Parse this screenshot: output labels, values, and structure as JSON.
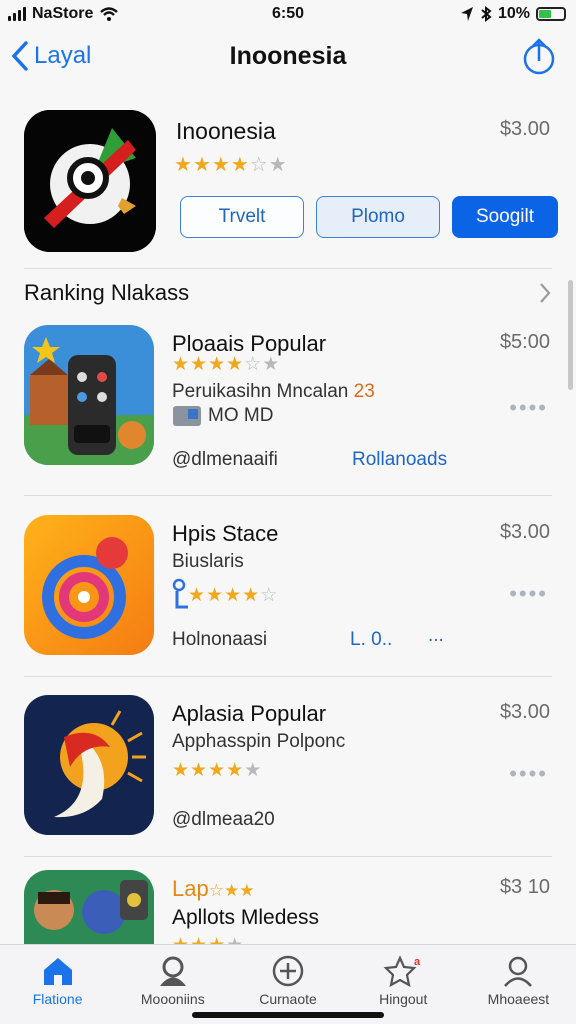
{
  "status_bar": {
    "carrier": "NaStore",
    "time": "6:50",
    "battery": "10%"
  },
  "nav": {
    "back_label": "Layal",
    "title": "Inoonesia"
  },
  "hero": {
    "name": "Inoonesia",
    "price": "$3.00",
    "rating_stars": 4,
    "rating_max": 5,
    "buttons": [
      "Trvelt",
      "Plomo",
      "Soogilt"
    ]
  },
  "section": {
    "title": "Ranking Nlakass"
  },
  "apps": [
    {
      "title": "Ploaais Popular",
      "price": "$5:00",
      "rating_stars": 4,
      "rating_max": 5,
      "subtitle": "Peruikasihn Mncalan",
      "subtitle_accent": "23",
      "tag_text": "MO MD",
      "developer": "@dlmenaaifi",
      "link": "Rollanoads"
    },
    {
      "title": "Hpis Stace",
      "price": "$3.00",
      "rating_stars": 4,
      "rating_max": 5,
      "subtitle": "Biuslaris",
      "developer": "Holnonaasi",
      "link": "L. 0..",
      "link_extra": "..."
    },
    {
      "title": "Aplasia Popular",
      "price": "$3.00",
      "rating_stars": 5,
      "rating_max": 5,
      "subtitle": "Apphasspin Polponc",
      "developer": "@dlmeaa20"
    },
    {
      "title": "Lap",
      "price": "$3 10",
      "rating_stars": 3,
      "rating_max": 5,
      "subtitle": "Apllots Mledess"
    }
  ],
  "tabs": [
    {
      "label": "Flatione",
      "icon": "home-icon",
      "active": true
    },
    {
      "label": "Moooniins",
      "icon": "person-icon",
      "active": false
    },
    {
      "label": "Curnaote",
      "icon": "plus-icon",
      "active": false
    },
    {
      "label": "Hingout",
      "icon": "star-icon",
      "active": false
    },
    {
      "label": "Mhoaeest",
      "icon": "account-icon",
      "active": false
    }
  ],
  "colors": {
    "accent": "#1a73e8",
    "star": "#f0a81c",
    "primary_button": "#0b63e6"
  }
}
